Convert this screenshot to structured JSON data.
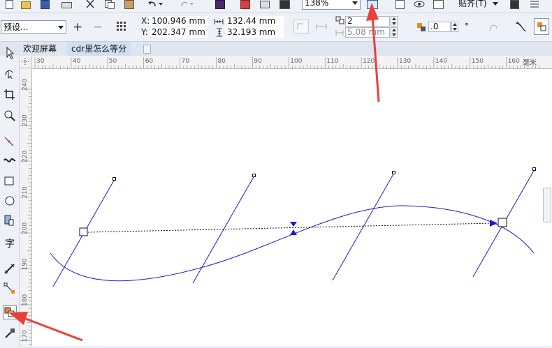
{
  "std_toolbar": {
    "zoom_value": "138%",
    "snap_label": "贴齐(T)"
  },
  "prop_bar": {
    "preset_value": "预设...",
    "x_label": "X:",
    "x_value": "100.946 mm",
    "y_label": "Y:",
    "y_value": "202.347 mm",
    "width_value": "132.44 mm",
    "height_value": "32.193 mm",
    "steps_value": "2",
    "spacing_value": "5.08 mm",
    "angle_value": ".0",
    "angle_unit": "°"
  },
  "tabs": [
    {
      "label": "欢迎屏幕"
    },
    {
      "label": "cdr里怎么等分"
    }
  ],
  "rulers": {
    "unit_label": "毫米",
    "h_ticks": [
      "30",
      "40",
      "50",
      "60",
      "70",
      "80",
      "90",
      "100",
      "110",
      "120",
      "130",
      "140",
      "150",
      "160"
    ],
    "v_ticks": [
      "240",
      "230",
      "220",
      "210",
      "200",
      "190",
      "180",
      "170"
    ]
  },
  "colors": {
    "accent_blue": "#1a1acc",
    "annotation_red": "#e8413a",
    "canvas": "#ffffff",
    "toolbar_bg": "#eef2f8"
  }
}
